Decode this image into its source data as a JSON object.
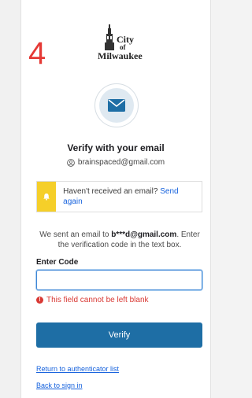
{
  "step_number": "4",
  "logo": {
    "line1": "City",
    "line2": "of",
    "line3": "Milwaukee"
  },
  "header": {
    "title": "Verify with your email",
    "identity": "brainspaced@gmail.com"
  },
  "callout": {
    "text": "Haven't received an email?",
    "link": "Send again"
  },
  "description": {
    "prefix": "We sent an email to ",
    "email": "b***d@gmail.com",
    "suffix": ". Enter the verification code in the text box."
  },
  "form": {
    "code_label": "Enter Code",
    "code_value": "",
    "error": "This field cannot be left blank",
    "verify_label": "Verify"
  },
  "links": {
    "return": "Return to authenticator list",
    "back": "Back to sign in"
  },
  "colors": {
    "accent": "#1e6ea5",
    "error": "#d93934",
    "warning": "#f5cf29",
    "link": "#1662dd",
    "step_number": "#e53935"
  }
}
